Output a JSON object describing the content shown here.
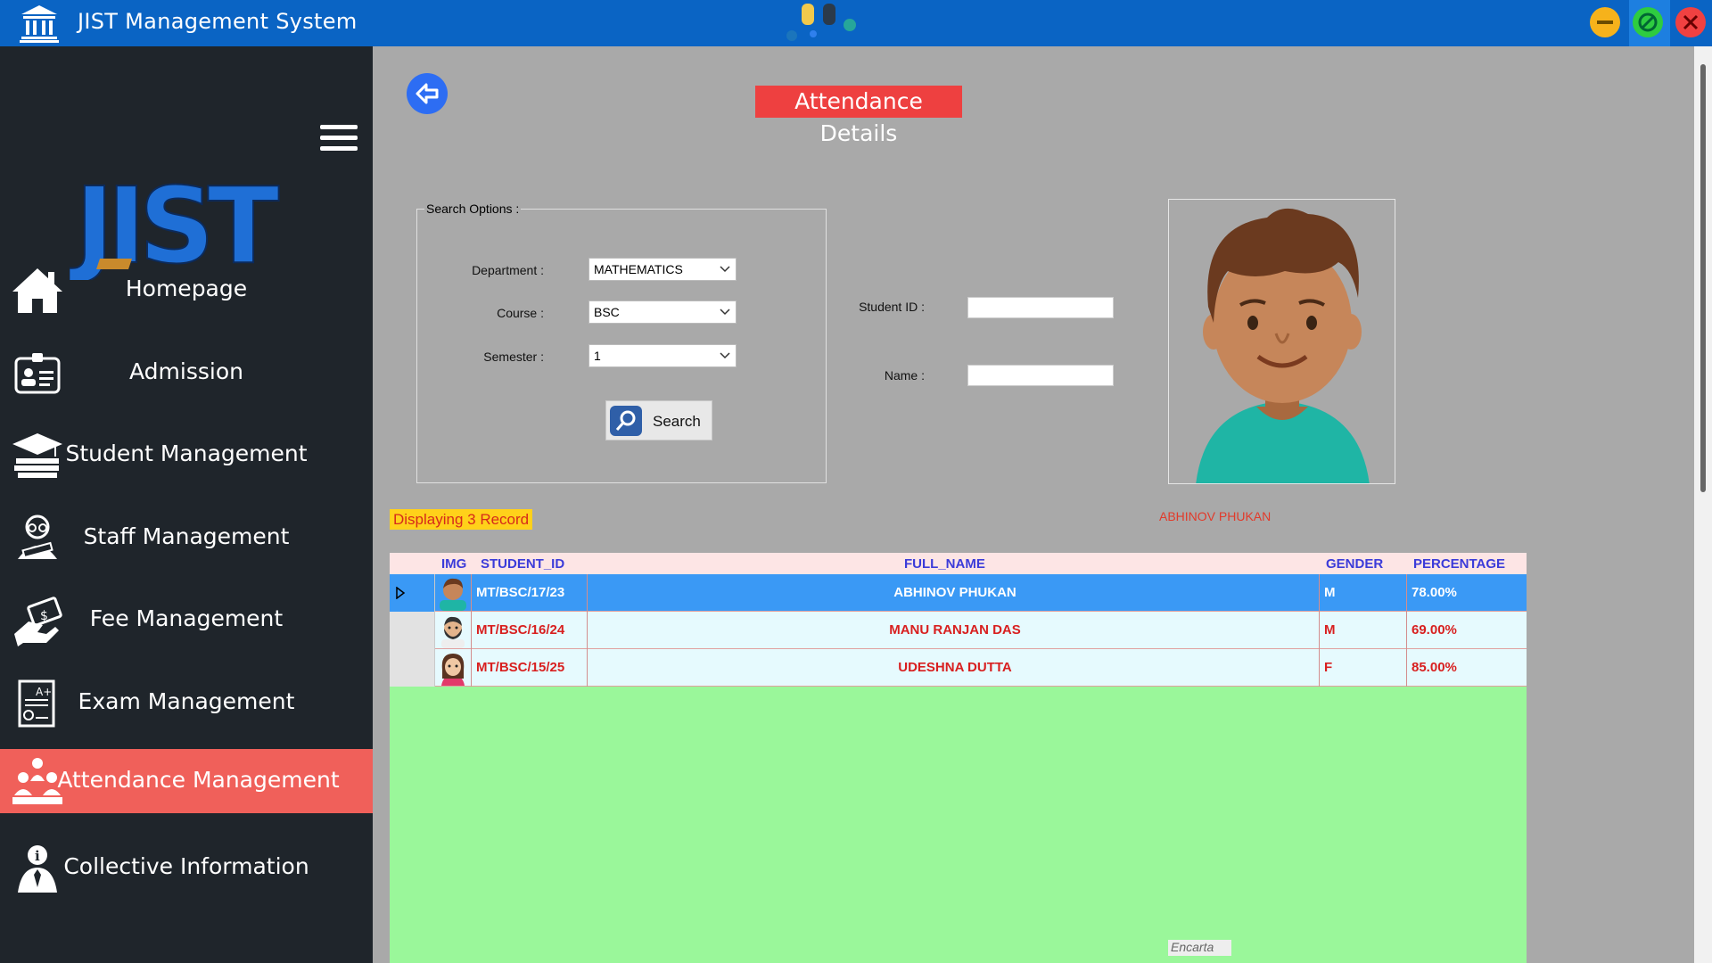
{
  "window": {
    "title": "JIST Management System",
    "colors": {
      "titlebar": "#0a64c4",
      "minimize": "#f6b21b",
      "maximize": "#2ecc40",
      "close": "#f04141"
    }
  },
  "sidebar": {
    "logo_text": "JIST",
    "items": [
      {
        "label": "Homepage",
        "icon": "home-icon",
        "active": false
      },
      {
        "label": "Admission",
        "icon": "id-card-icon",
        "active": false
      },
      {
        "label": "Student Management",
        "icon": "graduation-cap-icon",
        "active": false
      },
      {
        "label": "Staff Management",
        "icon": "teacher-icon",
        "active": false
      },
      {
        "label": "Fee Management",
        "icon": "money-hand-icon",
        "active": false
      },
      {
        "label": "Exam Management",
        "icon": "certificate-icon",
        "active": false
      },
      {
        "label": "Attendance Management",
        "icon": "classroom-icon",
        "active": true
      },
      {
        "label": "Collective Information",
        "icon": "info-person-icon",
        "active": false
      }
    ],
    "active_color": "#f0605a"
  },
  "page": {
    "title": "Attendance Details",
    "search_options": {
      "group_title": "Search Options :",
      "department_label": "Department :",
      "department_value": "MATHEMATICS",
      "course_label": "Course :",
      "course_value": "BSC",
      "semester_label": "Semester :",
      "semester_value": "1",
      "search_button": "Search"
    },
    "student_id_label": "Student ID :",
    "student_id_value": "",
    "name_label": "Name :",
    "name_value": "",
    "photo_name": "ABHINOV  PHUKAN",
    "records_text": "Displaying 3 Record",
    "watermark": "Encarta"
  },
  "grid": {
    "columns": [
      "IMG",
      "STUDENT_ID",
      "FULL_NAME",
      "GENDER",
      "PERCENTAGE"
    ],
    "rows": [
      {
        "student_id": "MT/BSC/17/23",
        "full_name": "ABHINOV  PHUKAN",
        "gender": "M",
        "percentage": "78.00%",
        "avatar": "boy-avatar-icon",
        "selected": true
      },
      {
        "student_id": "MT/BSC/16/24",
        "full_name": "MANU RANJAN DAS",
        "gender": "M",
        "percentage": "69.00%",
        "avatar": "bearded-man-avatar-icon",
        "selected": false
      },
      {
        "student_id": "MT/BSC/15/25",
        "full_name": "UDESHNA  DUTTA",
        "gender": "F",
        "percentage": "85.00%",
        "avatar": "girl-avatar-icon",
        "selected": false
      }
    ]
  }
}
